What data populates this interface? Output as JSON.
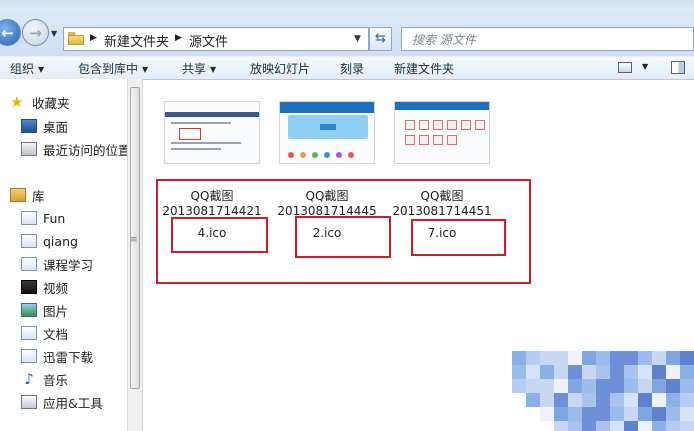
{
  "addressbar": {
    "breadcrumbs": [
      "新建文件夹",
      "源文件"
    ],
    "search_placeholder": "搜索 源文件"
  },
  "commandbar": {
    "items": [
      "组织",
      "包含到库中",
      "共享",
      "放映幻灯片",
      "刻录",
      "新建文件夹"
    ]
  },
  "navpane": {
    "favorites_label": "收藏夹",
    "favorites": [
      "桌面",
      "最近访问的位置"
    ],
    "libraries_label": "库",
    "libraries": [
      "Fun",
      "qiang",
      "课程学习",
      "视频",
      "图片",
      "文档",
      "迅雷下载",
      "音乐",
      "应用&工具"
    ]
  },
  "files": [
    {
      "line1": "QQ截图",
      "line2": "2013081714421",
      "line3": "4.ico"
    },
    {
      "line1": "QQ截图",
      "line2": "2013081714445",
      "line3": "2.ico"
    },
    {
      "line1": "QQ截图",
      "line2": "2013081714451",
      "line3": "7.ico"
    }
  ],
  "colors": {
    "annotation_red": "#c91f2a",
    "toolbar_bg": "#e3edf8"
  }
}
